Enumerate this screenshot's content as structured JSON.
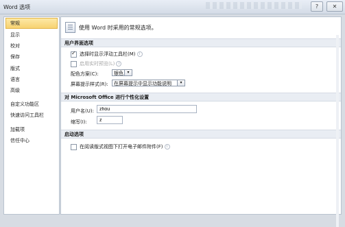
{
  "window": {
    "title": "Word 选项",
    "help_label": "?",
    "close_label": "✕"
  },
  "nav": {
    "items": [
      {
        "label": "常规",
        "selected": true
      },
      {
        "label": "显示"
      },
      {
        "label": "校对"
      },
      {
        "label": "保存"
      },
      {
        "label": "版式"
      },
      {
        "label": "语言"
      },
      {
        "label": "高级"
      },
      {
        "label": "自定义功能区"
      },
      {
        "label": "快速访问工具栏"
      },
      {
        "label": "加载项"
      },
      {
        "label": "信任中心"
      }
    ]
  },
  "main": {
    "intro": "使用 Word 时采用的常规选项。",
    "ui_section": {
      "header": "用户界面选项",
      "show_minibar": "选择时显示浮动工具栏(M)",
      "live_preview": "启用实时预览(L)",
      "color_scheme_label": "配色方案(C):",
      "color_scheme_value": "银色",
      "screentip_label": "屏幕提示样式(R):",
      "screentip_value": "在屏幕提示中显示功能说明"
    },
    "personalize_section": {
      "header": "对 Microsoft Office 进行个性化设置",
      "username_label": "用户名(U):",
      "username_value": "zhou",
      "initials_label": "缩写(I):",
      "initials_value": "z"
    },
    "startup_section": {
      "header": "启动选项",
      "open_email_reading": "在阅读版式视图下打开电子邮件附件(F)"
    }
  }
}
